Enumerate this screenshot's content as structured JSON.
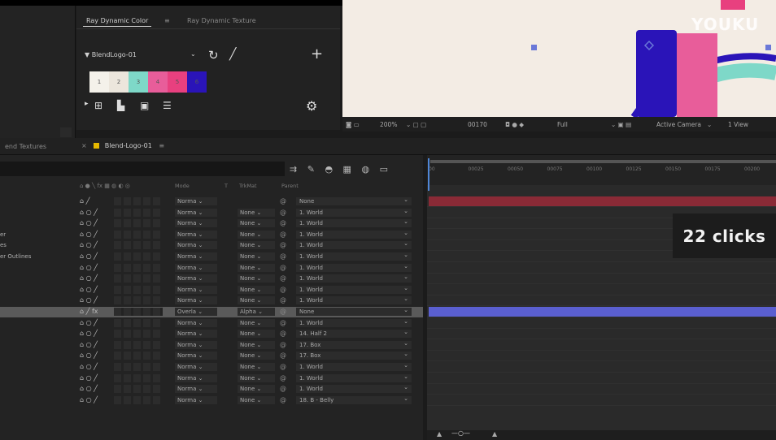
{
  "panel": {
    "tabs": [
      "Ray Dynamic Color",
      "Ray Dynamic Texture"
    ],
    "palette_name": "▼ BlendLogo-01",
    "swatches": [
      {
        "label": "1",
        "color": "#f4f1ea"
      },
      {
        "label": "2",
        "color": "#ece6dc"
      },
      {
        "label": "3",
        "color": "#7ed8c8"
      },
      {
        "label": "4",
        "color": "#e85d9a"
      },
      {
        "label": "5",
        "color": "#e8407f"
      },
      {
        "label": "6",
        "color": "#2a14b8"
      }
    ]
  },
  "viewer_toolbar": {
    "zoom": "200%",
    "timecode": "00170",
    "resolution": "Full",
    "camera": "Active Camera",
    "view": "1 View"
  },
  "comp_tabs": {
    "textures_tab": "end Textures",
    "comp_tab": "Blend-Logo-01"
  },
  "layer_columns": {
    "mode": "Mode",
    "t": "T",
    "trkmat": "TrkMat",
    "parent": "Parent"
  },
  "layers": [
    {
      "name": "",
      "switches": "⌂ ╱",
      "mode": "Norma ⌄",
      "trkmat": "",
      "parent": "None"
    },
    {
      "name": "",
      "switches": "⌂ ○ ╱",
      "mode": "Norma ⌄",
      "trkmat": "None ⌄",
      "parent": "1. World"
    },
    {
      "name": "",
      "switches": "⌂ ○ ╱",
      "mode": "Norma ⌄",
      "trkmat": "None ⌄",
      "parent": "1. World"
    },
    {
      "name": "er",
      "switches": "⌂ ○ ╱",
      "mode": "Norma ⌄",
      "trkmat": "None ⌄",
      "parent": "1. World"
    },
    {
      "name": "es",
      "switches": "⌂ ○ ╱",
      "mode": "Norma ⌄",
      "trkmat": "None ⌄",
      "parent": "1. World"
    },
    {
      "name": "er Outlines",
      "switches": "⌂ ○ ╱",
      "mode": "Norma ⌄",
      "trkmat": "None ⌄",
      "parent": "1. World"
    },
    {
      "name": "",
      "switches": "⌂ ○ ╱",
      "mode": "Norma ⌄",
      "trkmat": "None ⌄",
      "parent": "1. World"
    },
    {
      "name": "",
      "switches": "⌂ ○ ╱",
      "mode": "Norma ⌄",
      "trkmat": "None ⌄",
      "parent": "1. World"
    },
    {
      "name": "",
      "switches": "⌂ ○ ╱",
      "mode": "Norma ⌄",
      "trkmat": "None ⌄",
      "parent": "1. World"
    },
    {
      "name": "",
      "switches": "⌂ ○ ╱",
      "mode": "Norma ⌄",
      "trkmat": "None ⌄",
      "parent": "1. World"
    },
    {
      "name": "",
      "switches": "⌂ ╱ fx",
      "mode": "Overla ⌄",
      "trkmat": "Alpha ⌄",
      "parent": "None"
    },
    {
      "name": "",
      "switches": "⌂ ○ ╱",
      "mode": "Norma ⌄",
      "trkmat": "None ⌄",
      "parent": "1. World"
    },
    {
      "name": "",
      "switches": "⌂ ○ ╱",
      "mode": "Norma ⌄",
      "trkmat": "None ⌄",
      "parent": "14. Half 2"
    },
    {
      "name": "",
      "switches": "⌂ ○ ╱",
      "mode": "Norma ⌄",
      "trkmat": "None ⌄",
      "parent": "17. Box"
    },
    {
      "name": "",
      "switches": "⌂ ○ ╱",
      "mode": "Norma ⌄",
      "trkmat": "None ⌄",
      "parent": "17. Box"
    },
    {
      "name": "",
      "switches": "⌂ ○ ╱",
      "mode": "Norma ⌄",
      "trkmat": "None ⌄",
      "parent": "1. World"
    },
    {
      "name": "",
      "switches": "⌂ ○ ╱",
      "mode": "Norma ⌄",
      "trkmat": "None ⌄",
      "parent": "1. World"
    },
    {
      "name": "",
      "switches": "⌂ ○ ╱",
      "mode": "Norma ⌄",
      "trkmat": "None ⌄",
      "parent": "1. World"
    },
    {
      "name": "",
      "switches": "⌂ ○ ╱",
      "mode": "Norma ⌄",
      "trkmat": "None ⌄",
      "parent": "18. B - Belly"
    }
  ],
  "timeline": {
    "ruler": [
      "00",
      "00025",
      "00050",
      "00075",
      "00100",
      "00125",
      "00150",
      "00175",
      "00200"
    ],
    "bar_colors": [
      "#8a2a36",
      null,
      null,
      null,
      null,
      null,
      null,
      null,
      null,
      null,
      "#5a5fd0"
    ]
  },
  "overlay": {
    "clicks": "22  clicks",
    "watermark": "YOUKU"
  }
}
